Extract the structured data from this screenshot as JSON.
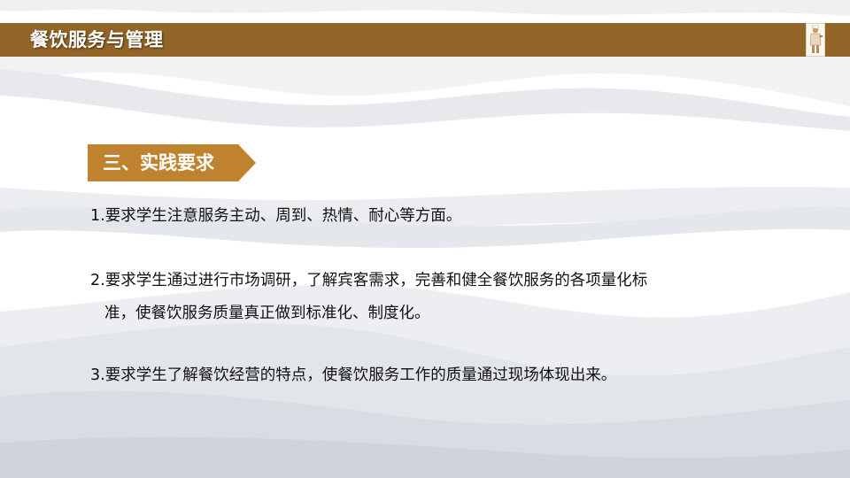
{
  "header": {
    "title": "餐饮服务与管理",
    "bar_color": "#926428"
  },
  "logo": {
    "icon": "chef-figure-logo"
  },
  "section": {
    "title": "三、实践要求",
    "tag_color": "#BF8330"
  },
  "requirements": [
    {
      "lines": [
        "1.要求学生注意服务主动、周到、热情、耐心等方面。"
      ]
    },
    {
      "lines": [
        "2.要求学生通过进行市场调研，了解宾客需求，完善和健全餐饮服务的各项量化标",
        "准，使餐饮服务质量真正做到标准化、制度化。"
      ]
    },
    {
      "lines": [
        "3.要求学生了解餐饮经营的特点，使餐饮服务工作的质量通过现场体现出来。"
      ]
    }
  ]
}
